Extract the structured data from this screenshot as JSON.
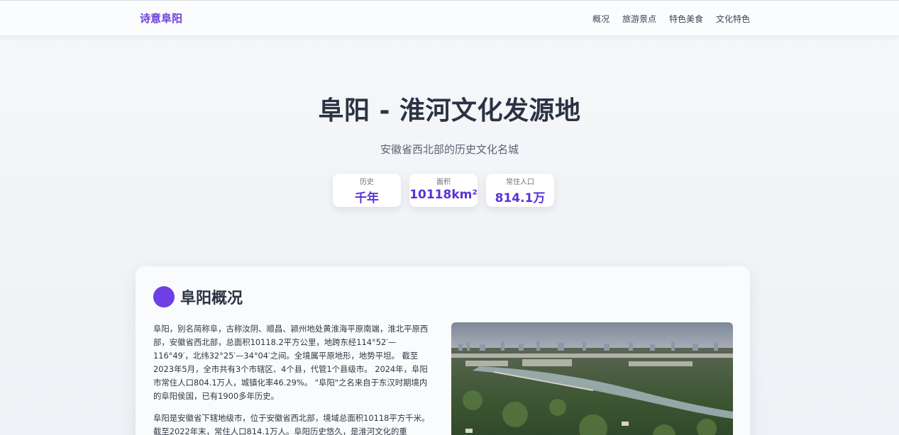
{
  "header": {
    "brand": "诗意阜阳",
    "nav": [
      "概况",
      "旅游景点",
      "特色美食",
      "文化特色"
    ]
  },
  "hero": {
    "title": "阜阳 - 淮河文化发源地",
    "subtitle": "安徽省西北部的历史文化名城",
    "stats": [
      {
        "label": "历史",
        "value": "千年"
      },
      {
        "label": "面积",
        "value": "10118km²"
      },
      {
        "label": "常住人口",
        "value": "814.1万"
      }
    ]
  },
  "overview": {
    "title": "阜阳概况",
    "paragraph1": "阜阳，别名简称阜，古称汝阴、顺昌、颍州地处黄淮海平原南端，淮北平原西部，安徽省西北部，总面积10118.2平方公里，地跨东经114°52′—116°49′，北纬32°25′—34°04′之间。全境属平原地形，地势平坦。 截至2023年5月，全市共有3个市辖区、4个县，代管1个县级市。 2024年，阜阳市常住人口804.1万人，城镇化率46.29%。 \"阜阳\"之名来自于东汉时期境内的阜阳侯国，已有1900多年历史。",
    "paragraph2": "阜阳是安徽省下辖地级市，位于安徽省西北部，境域总面积10118平方千米。截至2022年末，常住人口814.1万人。阜阳历史悠久，是淮河文化的重",
    "image_alt": "阜阳城市航拍"
  },
  "colors": {
    "accent": "#6d3fe0",
    "stat_value": "#5a32d6",
    "title": "#2a3344"
  }
}
